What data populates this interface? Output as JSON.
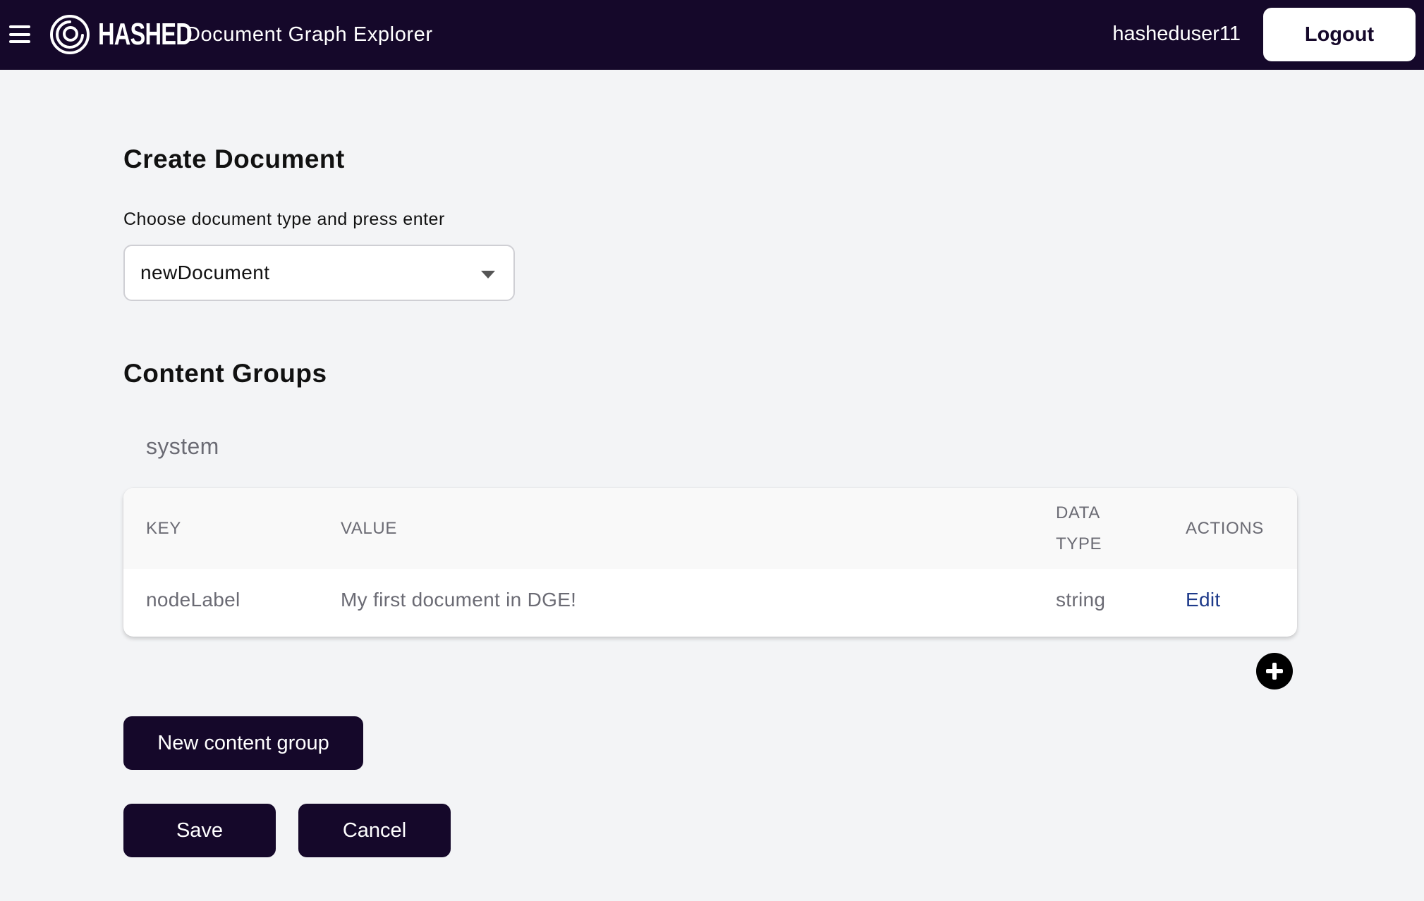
{
  "header": {
    "menu_icon": "hamburger-menu-icon",
    "logo_icon": "spiral-logo-icon",
    "logo_text": "HASHED",
    "app_title": "Document Graph Explorer",
    "username": "hasheduser11",
    "logout_label": "Logout",
    "background_color": "#15082a"
  },
  "create": {
    "title": "Create Document",
    "choose_label": "Choose document type and press enter",
    "selected_type": "newDocument",
    "dropdown_icon": "caret-down-icon"
  },
  "groups": {
    "title": "Content Groups",
    "items": [
      {
        "name": "system",
        "columns": [
          "KEY",
          "VALUE",
          "DATA TYPE",
          "ACTIONS"
        ],
        "rows": [
          {
            "key": "nodeLabel",
            "value": "My first document in DGE!",
            "data_type": "string",
            "action": "Edit"
          }
        ]
      }
    ],
    "add_icon": "plus-circle-icon"
  },
  "actions": {
    "new_group_label": "New content group",
    "save_label": "Save",
    "cancel_label": "Cancel"
  },
  "colors": {
    "accent": "#15082a",
    "link": "#1e3a8a",
    "page_background": "#f3f4f6"
  }
}
